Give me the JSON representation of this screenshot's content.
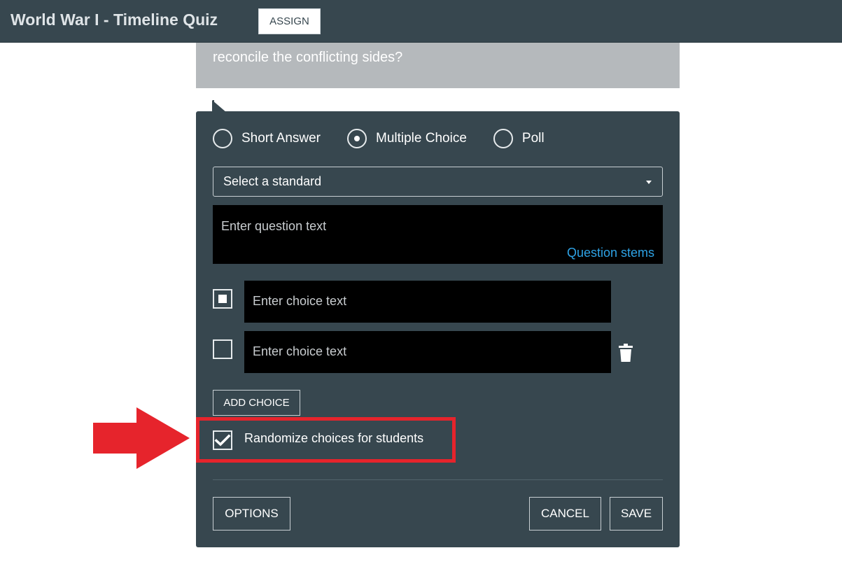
{
  "header": {
    "title": "World War I - Timeline Quiz",
    "assign_label": "ASSIGN"
  },
  "previous_question": {
    "text_line2": "reconcile the conflicting sides?"
  },
  "editor": {
    "question_types": [
      {
        "label": "Short Answer",
        "selected": false
      },
      {
        "label": "Multiple Choice",
        "selected": true
      },
      {
        "label": "Poll",
        "selected": false
      }
    ],
    "standard_select": {
      "value": "Select a standard"
    },
    "question": {
      "placeholder": "Enter question text",
      "stems_link": "Question stems"
    },
    "choices": [
      {
        "placeholder": "Enter choice text",
        "correct": true
      },
      {
        "placeholder": "Enter choice text",
        "correct": false
      }
    ],
    "add_choice_label": "ADD CHOICE",
    "randomize": {
      "label": "Randomize choices for students",
      "checked": true
    },
    "options_label": "OPTIONS",
    "cancel_label": "CANCEL",
    "save_label": "SAVE"
  },
  "colors": {
    "header_bg": "#37474f",
    "panel_bg": "#37474f",
    "link": "#2ea3e6",
    "annotation": "#e6242c"
  },
  "icons": [
    "radio-icon",
    "chevron-down-icon",
    "trash-icon",
    "checkmark-icon",
    "arrow-right-icon"
  ]
}
